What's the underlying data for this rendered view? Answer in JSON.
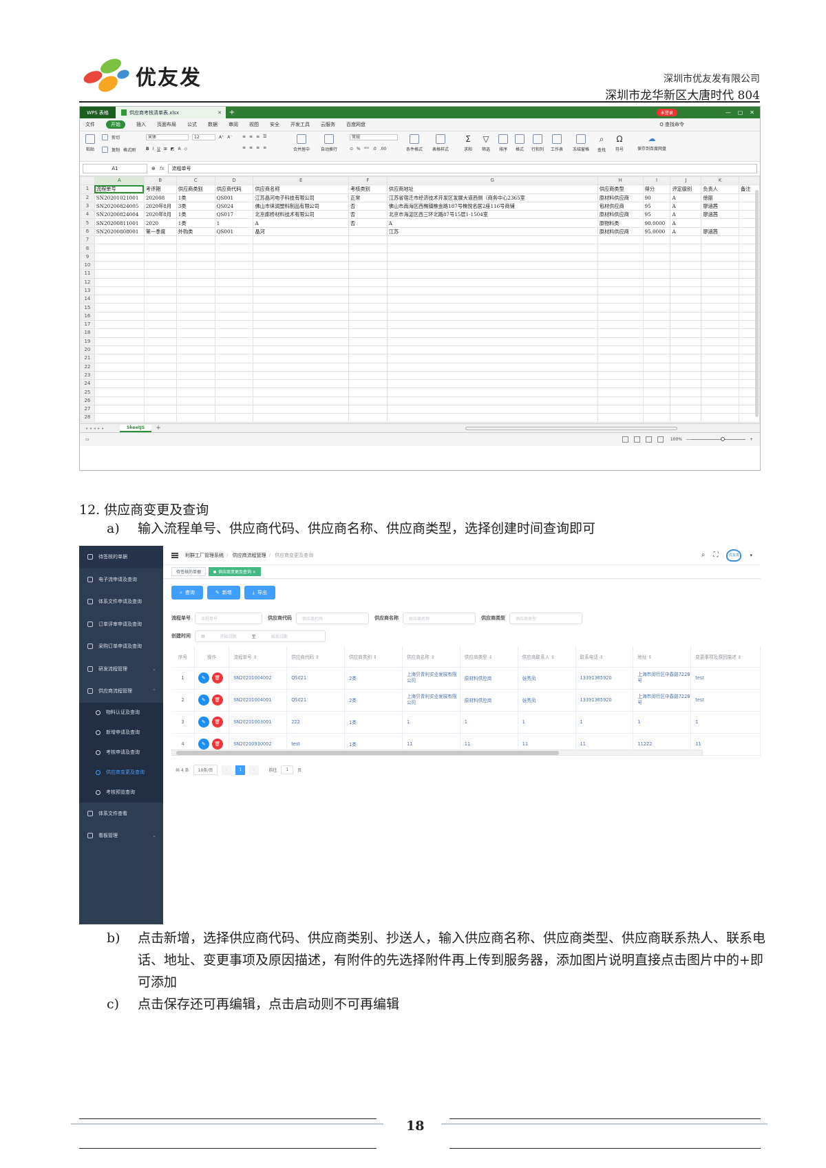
{
  "header": {
    "logo_text": "优友发",
    "company": "深圳市优友发有限公司",
    "address": "深圳市龙华新区大唐时代 804"
  },
  "wps": {
    "app_badge": "WPS 表格",
    "file_tab": "供应商考核清单表.xlsx",
    "login": "未登录",
    "menu": [
      "文件",
      "开始",
      "插入",
      "页面布局",
      "公式",
      "数据",
      "审阅",
      "视图",
      "安全",
      "开发工具",
      "云服务",
      "百度网盘"
    ],
    "search_cmd": "Q 查找命令",
    "ribbon": {
      "paste": "粘贴",
      "cut": "剪切",
      "copy": "复制",
      "format_painter": "格式刷",
      "font": "宋体",
      "font_size": "12",
      "merge": "合并居中",
      "wrap": "自动换行",
      "number_format": "常规",
      "cond_format": "条件格式",
      "table_style": "表格样式",
      "sum": "求和",
      "filter": "筛选",
      "sort": "排序",
      "format": "格式",
      "row_col": "行和列",
      "worksheet": "工作表",
      "freeze": "冻结窗格",
      "find": "查找",
      "symbol": "符号",
      "save_cloud": "保存到百度网盘"
    },
    "name_box": "A1",
    "fx": "fx",
    "formula": "流程单号",
    "columns": [
      "A",
      "B",
      "C",
      "D",
      "E",
      "F",
      "G",
      "H",
      "I",
      "J",
      "K",
      ""
    ],
    "rows": [
      [
        "流程单号",
        "考评期",
        "供应商类别",
        "供应商代码",
        "供应商名称",
        "考核类别",
        "供应商地址",
        "供应商类型",
        "得分",
        "评定级别",
        "负责人",
        "备注"
      ],
      [
        "SN20201021001",
        "202008",
        "1类",
        "QS001",
        "江苏晶河电子科技有限公司",
        "正常",
        "江苏省宿迁市经济技术开发区发展大道西侧（商务中心2365室",
        "原材料供应商",
        "90",
        "A",
        "徐丽",
        ""
      ],
      [
        "SN20200824005",
        "2020年8月",
        "3类",
        "QS024",
        "佛山市徕润塑料制品有限公司",
        "否",
        "佛山市南海区西樵镇樵金路187号樵悦名居2座116号商铺",
        "包材供应商",
        "95",
        "A",
        "廖涵茜",
        ""
      ],
      [
        "SN20200824004",
        "2020年8月",
        "1类",
        "QS017",
        "北京廊桥材料技术有限公司",
        "否",
        "北京市海淀区西三环北路87号15层1-1504室",
        "原材料供应商",
        "95",
        "A",
        "廖涵茜",
        ""
      ],
      [
        "SN20200811001",
        "2020",
        "1类",
        "1",
        "A",
        "否",
        "A",
        "原物料类",
        "90.0000",
        "A",
        "",
        ""
      ],
      [
        "SN20200808001",
        "第一季度",
        "外购类",
        "QS001",
        "晶河",
        "",
        "江苏",
        "原材料供应商",
        "95.0000",
        "A",
        "廖涵茜",
        ""
      ]
    ],
    "row_count": 28,
    "sheet_tab": "SheetJS",
    "zoom": "100%"
  },
  "section": {
    "title": "12. 供应商变更及查询",
    "step_a_label": "a)",
    "step_a": "输入流程单号、供应商代码、供应商名称、供应商类型，选择创建时间查询即可",
    "step_b_label": "b)",
    "step_b": "点击新增，选择供应商代码、供应商类别、抄送人，输入供应商名称、供应商类型、供应商联系热人、联系电话、地址、变更事项及原因描述，有附件的先选择附件再上传到服务器，添加图片说明直接点击图片中的+即可添加",
    "step_c_label": "c)",
    "step_c": "点击保存还可再编辑，点击启动则不可再编辑"
  },
  "app": {
    "sidebar": {
      "items": [
        {
          "label": "待签核的单据",
          "top": true
        },
        {
          "label": "电子流申请及查询"
        },
        {
          "label": "体系文件申请及查询"
        },
        {
          "label": "订单评审申请及查询"
        },
        {
          "label": "采购订单申请及查询"
        },
        {
          "label": "研发流程管理",
          "chev": "⌄"
        },
        {
          "label": "供应商流程管理",
          "chev": "⌃"
        }
      ],
      "subitems": [
        {
          "label": "物料认证及查询"
        },
        {
          "label": "新增申请及查询"
        },
        {
          "label": "考核申请及查询"
        },
        {
          "label": "供应商变更及查询",
          "active": true
        },
        {
          "label": "考核预览查询"
        }
      ],
      "bottom": [
        {
          "label": "体系文件查看"
        },
        {
          "label": "看板管理",
          "chev": "⌄"
        }
      ]
    },
    "breadcrumb": [
      "利群工厂管理系统",
      "供应商流程管理",
      "供应商变更及查询"
    ],
    "tabs": [
      "待签核的单据",
      "供应商变更及查询 ×"
    ],
    "buttons": {
      "query": "查询",
      "add": "新增",
      "export": "导出"
    },
    "form": {
      "flow_label": "流程单号",
      "flow_ph": "流程单号",
      "code_label": "供应商代码",
      "code_ph": "供应商代码",
      "name_label": "供应商名称",
      "name_ph": "供应商名称",
      "type_label": "供应商类型",
      "type_ph": "供应商类型",
      "time_label": "创建时间",
      "start_ph": "开始日期",
      "to": "至",
      "end_ph": "结束日期"
    },
    "table": {
      "headers": [
        "序号",
        "操作",
        "流程单号 ⇕",
        "供应商代码 ⇕",
        "供应商类别 ⇕",
        "供应商名称 ⇕",
        "供应商类型 ⇕",
        "供应商联系人 ⇕",
        "联系电话 ⇕",
        "地址 ⇕",
        "变更事项及原因描述 ⇕"
      ],
      "rows": [
        [
          "1",
          "",
          "SN20201004002",
          "QS021",
          "2类",
          "上海贝青利实业发展有限公司",
          "原材料供应商",
          "张秀凤",
          "13391365920",
          "上海市闵行区中春路7228号",
          "test"
        ],
        [
          "2",
          "",
          "SN20201004001",
          "QS021",
          "2类",
          "上海贝青利实业发展有限公司",
          "原材料供应商",
          "张秀凤",
          "13391365920",
          "上海市闵行区中春路7228号",
          "test"
        ],
        [
          "3",
          "",
          "SN20201003001",
          "222",
          "1类",
          "1",
          "1",
          "1",
          "1",
          "1",
          "1"
        ],
        [
          "4",
          "",
          "SN20200930002",
          "test",
          "1类",
          "11",
          "11",
          "11",
          "11",
          "11222",
          "11"
        ]
      ]
    },
    "pager": {
      "total": "共 4 条",
      "size": "10条/页",
      "page": "1",
      "goto": "前往",
      "goto_page": "1",
      "unit": "页"
    }
  },
  "footer": {
    "page": "18"
  }
}
